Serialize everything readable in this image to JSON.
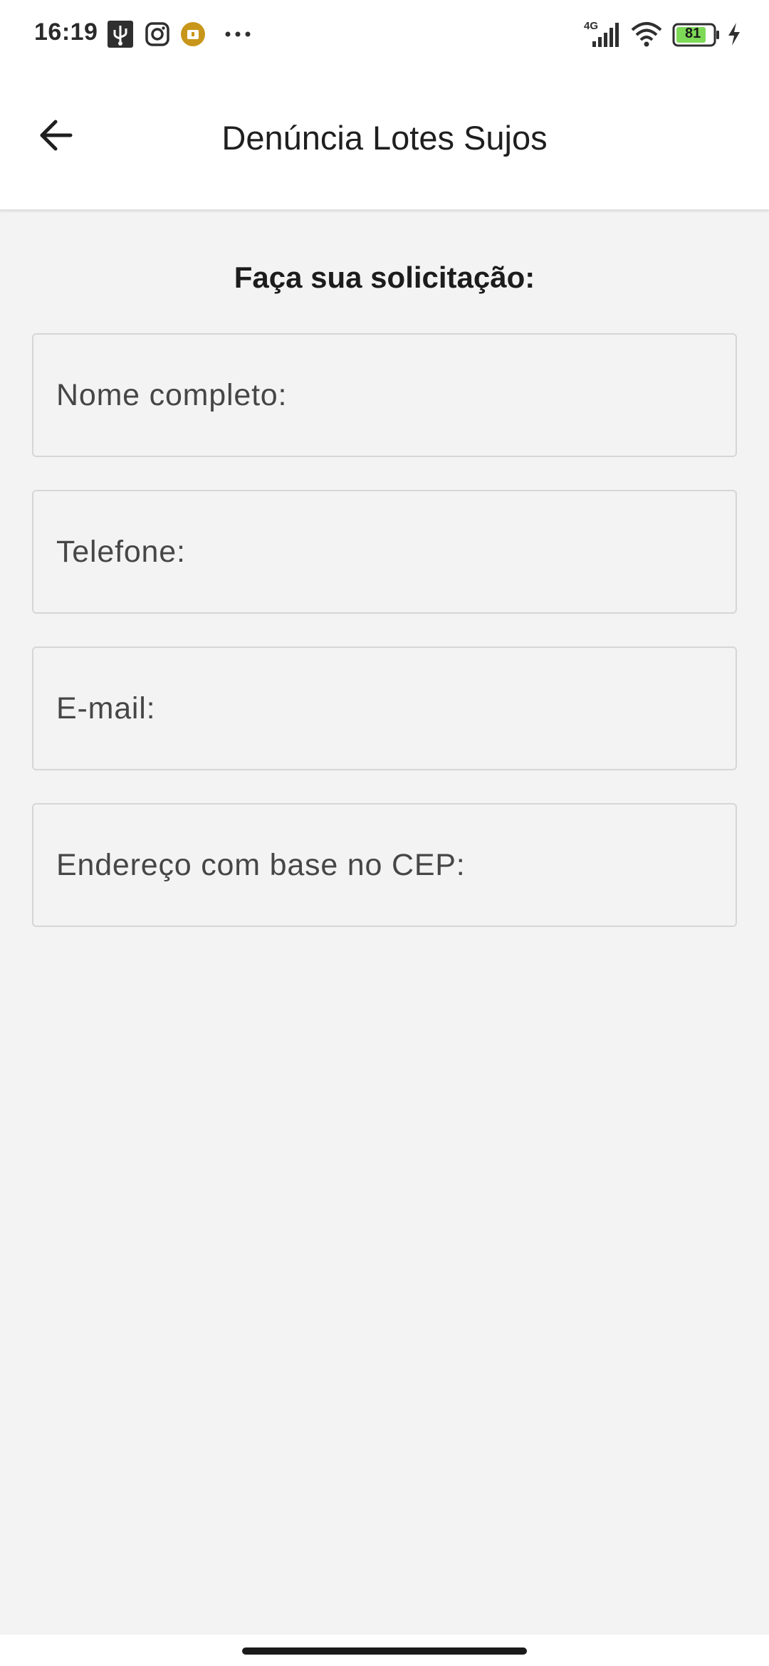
{
  "status_bar": {
    "time": "16:19",
    "network_type": "4G",
    "battery_level": "81",
    "icons": [
      "usb-icon",
      "instagram-icon",
      "download-notification-icon",
      "more-notifications-icon",
      "signal-icon",
      "wifi-icon",
      "battery-icon",
      "charging-icon"
    ]
  },
  "app_bar": {
    "title": "Denúncia Lotes Sujos",
    "back_icon": "arrow-left-icon"
  },
  "form": {
    "heading": "Faça sua solicitação:",
    "fields": [
      {
        "placeholder": "Nome completo:",
        "value": ""
      },
      {
        "placeholder": "Telefone:",
        "value": ""
      },
      {
        "placeholder": "E-mail:",
        "value": ""
      },
      {
        "placeholder": "Endereço com base no CEP:",
        "value": ""
      }
    ]
  },
  "colors": {
    "background": "#f3f3f3",
    "app_bar": "#ffffff",
    "field_border": "#d6d6d6",
    "battery_fill": "#7ed957",
    "notification_badge": "#c8961a"
  }
}
